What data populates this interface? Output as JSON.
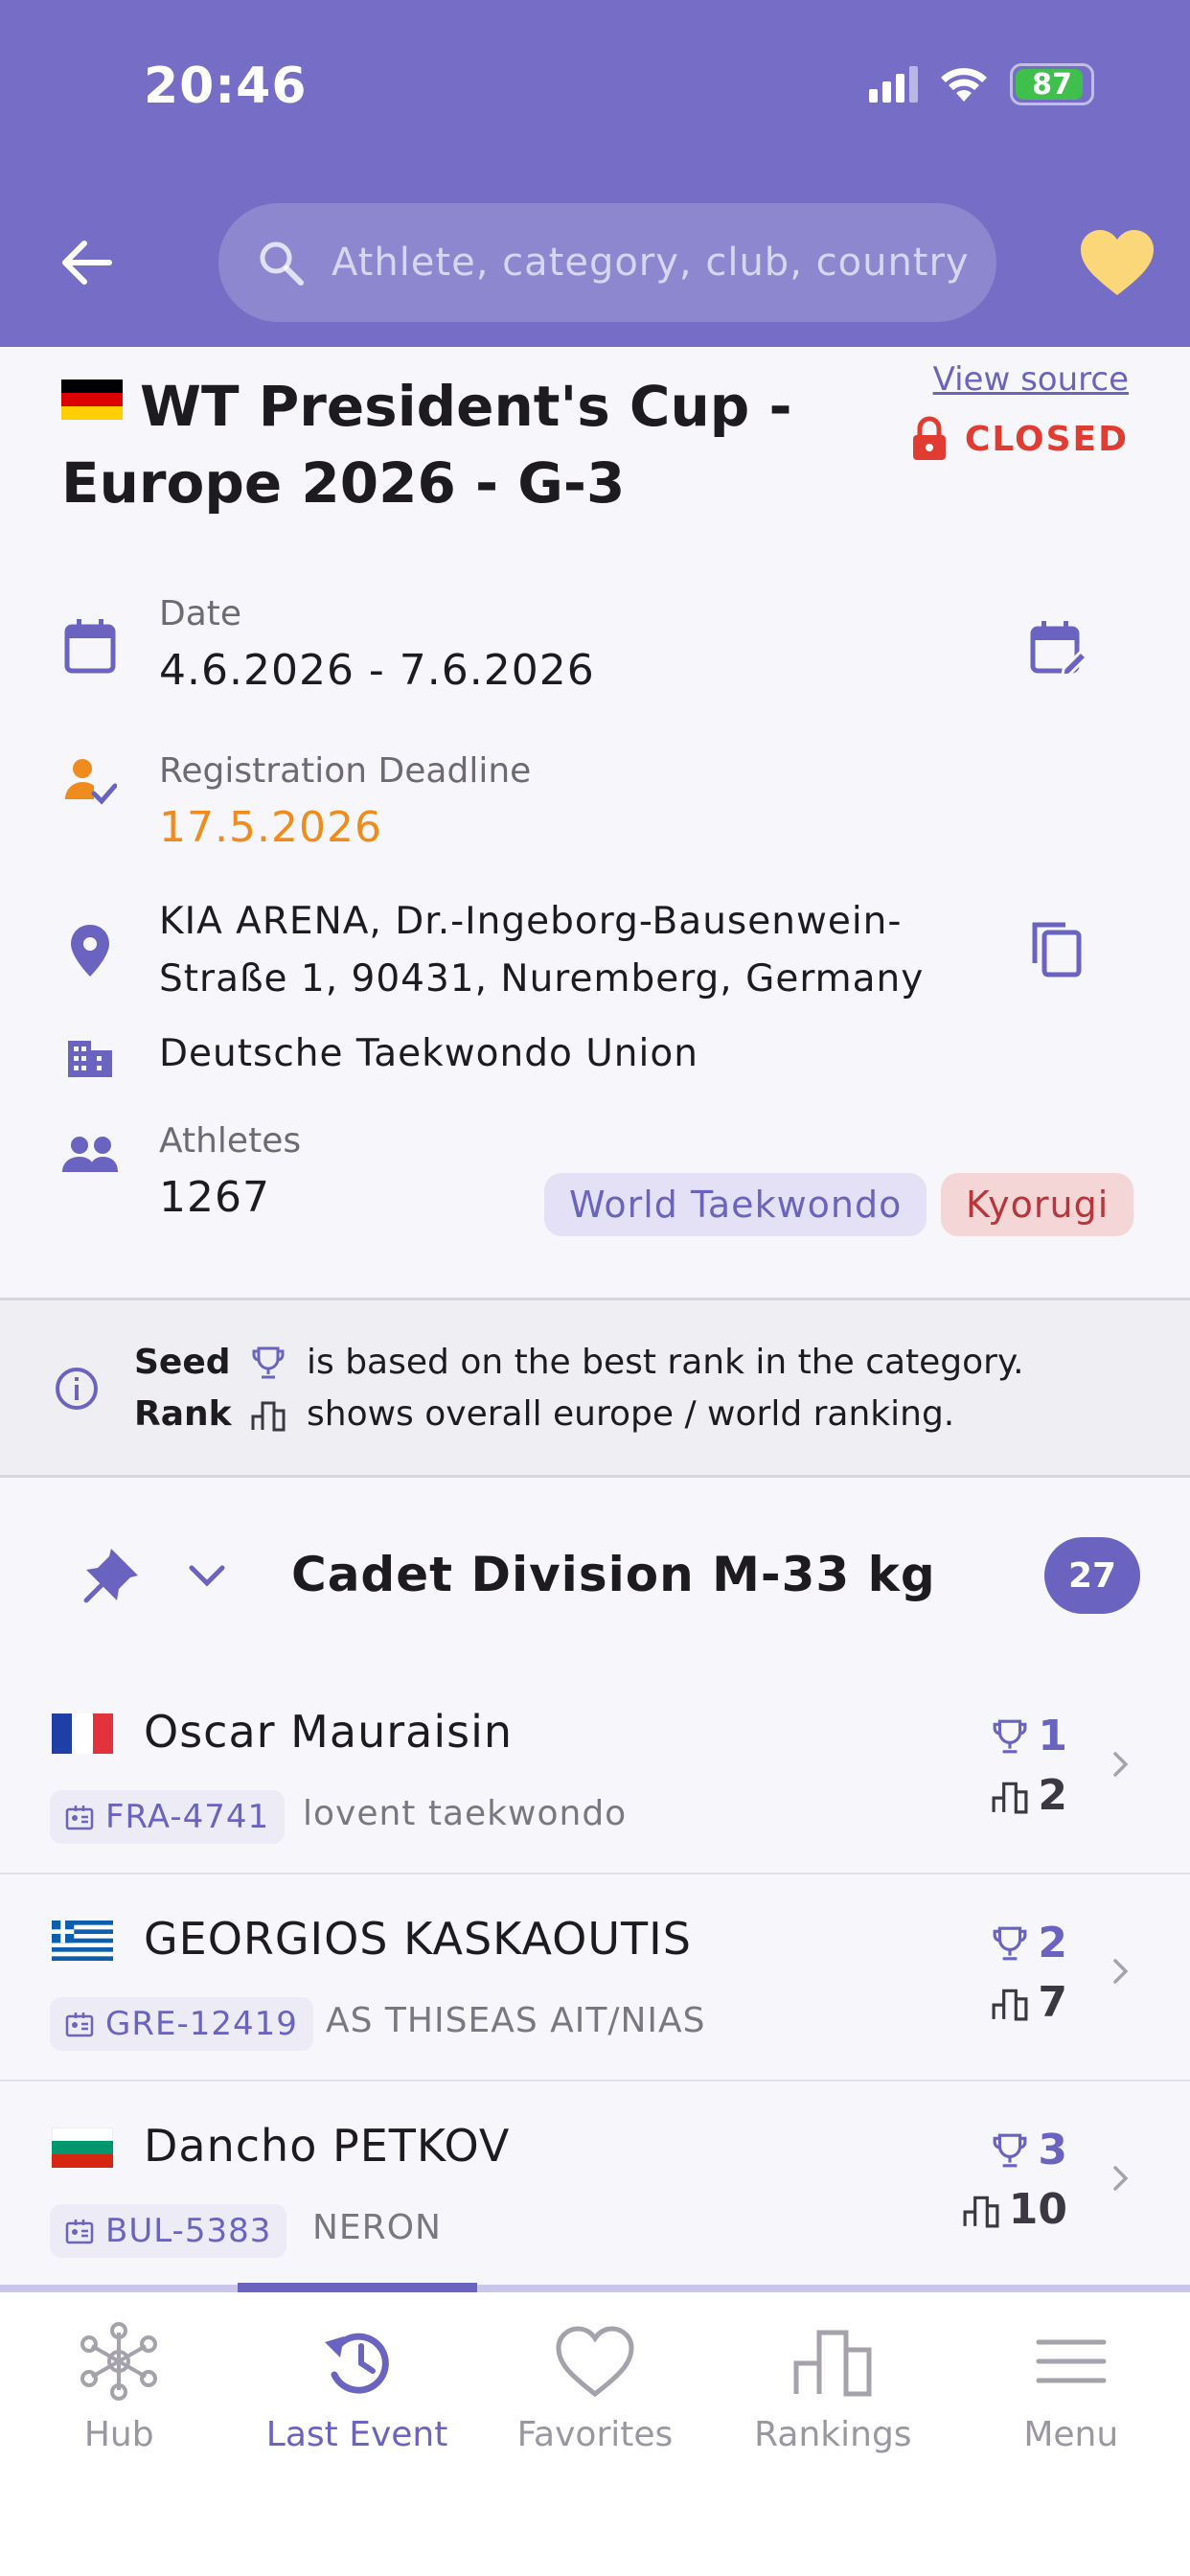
{
  "status_bar": {
    "time": "20:46",
    "battery": "87"
  },
  "header": {
    "search_placeholder": "Athlete, category, club, country"
  },
  "event": {
    "title": "WT President's Cup - Europe 2026 - G-3",
    "view_source": "View source",
    "status": "CLOSED",
    "date_label": "Date",
    "date_value": "4.6.2026 - 7.6.2026",
    "deadline_label": "Registration Deadline",
    "deadline_value": "17.5.2026",
    "address": "KIA ARENA, Dr.-Ingeborg-Bausenwein-Straße 1, 90431, Nuremberg, Germany",
    "organizer": "Deutsche Taekwondo Union",
    "athletes_label": "Athletes",
    "athletes_value": "1267",
    "chips": [
      "World Taekwondo",
      "Kyorugi"
    ],
    "colors": {
      "accent": "#6b63c0",
      "closed": "#e03c31",
      "deadline": "#f08b1e"
    }
  },
  "info": {
    "seed_label": "Seed",
    "seed_text": "is based on the best rank in the category.",
    "rank_label": "Rank",
    "rank_text": "shows overall europe / world ranking."
  },
  "division": {
    "title": "Cadet Division M-33 kg",
    "count": "27",
    "athletes": [
      {
        "name": "Oscar Mauraisin",
        "country": "France",
        "id": "FRA-4741",
        "club": "lovent taekwondo",
        "seed": "1",
        "rank": "2"
      },
      {
        "name": "GEORGIOS KASKAOUTIS",
        "country": "Greece",
        "id": "GRE-12419",
        "club": "AS THISEAS AIT/NIAS",
        "seed": "2",
        "rank": "7"
      },
      {
        "name": "Dancho PETKOV",
        "country": "Bulgaria",
        "id": "BUL-5383",
        "club": "NERON",
        "seed": "3",
        "rank": "10"
      }
    ]
  },
  "nav": {
    "items": [
      {
        "label": "Hub",
        "icon": "hub-icon"
      },
      {
        "label": "Last Event",
        "icon": "history-icon"
      },
      {
        "label": "Favorites",
        "icon": "heart-icon"
      },
      {
        "label": "Rankings",
        "icon": "podium-icon"
      },
      {
        "label": "Menu",
        "icon": "menu-icon"
      }
    ]
  }
}
